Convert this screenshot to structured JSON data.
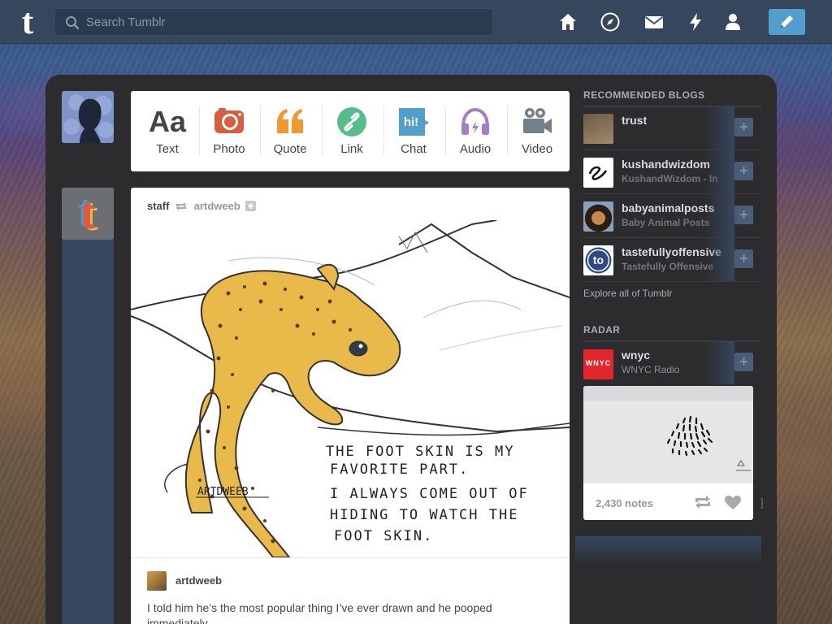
{
  "topbar": {
    "logo_letter": "t",
    "search_placeholder": "Search Tumblr",
    "icons": [
      "home-icon",
      "explore-compass-icon",
      "mail-icon",
      "activity-bolt-icon",
      "account-person-icon",
      "compose-pencil-icon"
    ],
    "accent": "#529ecc",
    "bg": "#36465d"
  },
  "post_types": [
    {
      "label": "Text",
      "icon": "text-aa-icon",
      "color": "#444444"
    },
    {
      "label": "Photo",
      "icon": "camera-icon",
      "color": "#d95e40"
    },
    {
      "label": "Quote",
      "icon": "quote-icon",
      "color": "#f2992e"
    },
    {
      "label": "Link",
      "icon": "link-icon",
      "color": "#56bc8a"
    },
    {
      "label": "Chat",
      "icon": "chat-bubble-icon",
      "color": "#529ecc"
    },
    {
      "label": "Audio",
      "icon": "headphones-icon",
      "color": "#a77dc2"
    },
    {
      "label": "Video",
      "icon": "video-camera-icon",
      "color": "#748089"
    }
  ],
  "post": {
    "blog": "staff",
    "reblogged_from": "artdweeb",
    "author": "artdweeb",
    "image_caption_lines": [
      "THE FOOT SKIN IS MY",
      "FAVORITE PART.",
      "I ALWAYS COME OUT OF",
      "HIDING TO WATCH THE",
      "FOOT SKIN."
    ],
    "image_signature": "ARTDWEEB",
    "body": "I told him he’s the most popular thing I’ve ever drawn and he pooped immediately."
  },
  "sidebar": {
    "recommended_heading": "RECOMMENDED BLOGS",
    "recommended": [
      {
        "name": "trust",
        "subtitle": ""
      },
      {
        "name": "kushandwizdom",
        "subtitle": "KushandWizdom - In"
      },
      {
        "name": "babyanimalposts",
        "subtitle": "Baby Animal Posts"
      },
      {
        "name": "tastefullyoffensive",
        "subtitle": "Tastefully Offensive"
      }
    ],
    "explore_link": "Explore all of Tumblr",
    "radar_heading": "RADAR",
    "radar": {
      "name": "wnyc",
      "subtitle": "WNYC Radio",
      "logo_text": "WNYC",
      "notes": "2,430 notes"
    },
    "bracket": "]"
  }
}
